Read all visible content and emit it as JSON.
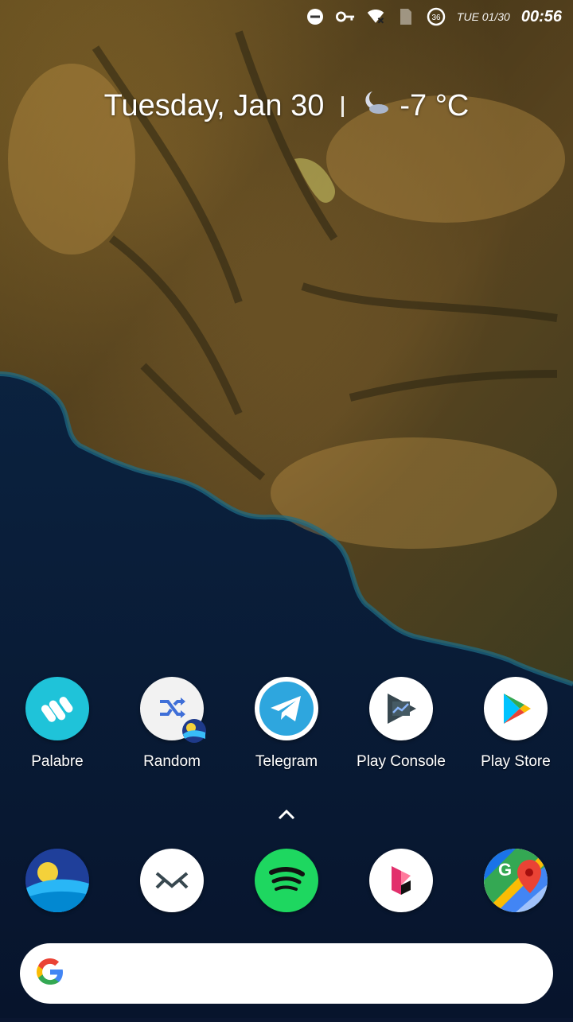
{
  "status_bar": {
    "date": "TUE 01/30",
    "time": "00:56",
    "icons": [
      "do-not-disturb-icon",
      "vpn-key-icon",
      "wifi-off-icon",
      "sim-icon",
      "battery-saver-icon"
    ],
    "data_badge": "36"
  },
  "glance": {
    "date": "Tuesday, Jan 30",
    "weather_icon": "moon-cloud-icon",
    "temperature": "-7 °C"
  },
  "apps": [
    {
      "label": "Palabre",
      "icon": "palabre-icon",
      "color": "#1fc3d9"
    },
    {
      "label": "Random",
      "icon": "shuffle-icon",
      "color": "#f2f2f2"
    },
    {
      "label": "Telegram",
      "icon": "telegram-icon",
      "color": "#2ea6de"
    },
    {
      "label": "Play Console",
      "icon": "play-console-icon",
      "color": "#ffffff"
    },
    {
      "label": "Play Store",
      "icon": "play-store-icon",
      "color": "#ffffff"
    }
  ],
  "dock": [
    {
      "icon": "wallpaper-app-icon"
    },
    {
      "icon": "mail-icon"
    },
    {
      "icon": "spotify-icon",
      "color": "#1ed760"
    },
    {
      "icon": "deezer-icon"
    },
    {
      "icon": "google-maps-icon"
    }
  ],
  "search": {
    "logo": "google-g-icon"
  }
}
